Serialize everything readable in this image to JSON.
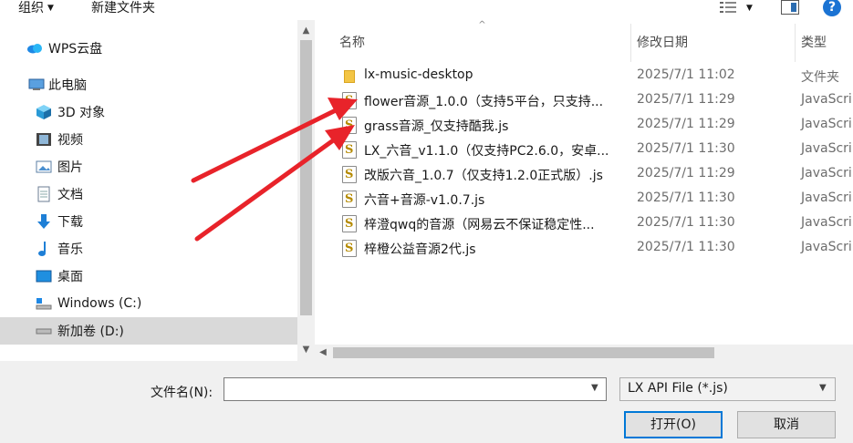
{
  "toolbar": {
    "organize_label": "组织",
    "newfolder_label": "新建文件夹",
    "help_label": "?"
  },
  "nav": {
    "items": [
      {
        "label": "WPS云盘",
        "icon": "cloud-icon"
      },
      {
        "label": "此电脑",
        "icon": "computer-icon"
      },
      {
        "label": "3D 对象",
        "icon": "cube-icon"
      },
      {
        "label": "视频",
        "icon": "video-icon"
      },
      {
        "label": "图片",
        "icon": "picture-icon"
      },
      {
        "label": "文档",
        "icon": "document-icon"
      },
      {
        "label": "下载",
        "icon": "download-icon"
      },
      {
        "label": "音乐",
        "icon": "music-icon"
      },
      {
        "label": "桌面",
        "icon": "desktop-icon"
      },
      {
        "label": "Windows (C:)",
        "icon": "drive-c-icon"
      },
      {
        "label": "新加卷 (D:)",
        "icon": "drive-d-icon"
      }
    ],
    "selected_index": 10
  },
  "list": {
    "columns": {
      "name": "名称",
      "date": "修改日期",
      "type": "类型"
    },
    "rows": [
      {
        "name": "lx-music-desktop",
        "date": "2025/7/1 11:02",
        "type": "文件夹",
        "kind": "folder"
      },
      {
        "name": "flower音源_1.0.0（支持5平台，只支持...",
        "date": "2025/7/1 11:29",
        "type": "JavaScri",
        "kind": "js"
      },
      {
        "name": "grass音源_仅支持酷我.js",
        "date": "2025/7/1 11:29",
        "type": "JavaScri",
        "kind": "js"
      },
      {
        "name": "LX_六音_v1.1.0（仅支持PC2.6.0，安卓...",
        "date": "2025/7/1 11:30",
        "type": "JavaScri",
        "kind": "js"
      },
      {
        "name": "改版六音_1.0.7（仅支持1.2.0正式版）.js",
        "date": "2025/7/1 11:29",
        "type": "JavaScri",
        "kind": "js"
      },
      {
        "name": "六音+音源-v1.0.7.js",
        "date": "2025/7/1 11:30",
        "type": "JavaScri",
        "kind": "js"
      },
      {
        "name": "梓澄qwq的音源（网易云不保证稳定性...",
        "date": "2025/7/1 11:30",
        "type": "JavaScri",
        "kind": "js"
      },
      {
        "name": "梓橙公益音源2代.js",
        "date": "2025/7/1 11:30",
        "type": "JavaScri",
        "kind": "js"
      }
    ]
  },
  "bottom": {
    "filename_label": "文件名(N):",
    "filename_value": "",
    "filetype_value": "LX API File (*.js)",
    "open_label": "打开(O)",
    "cancel_label": "取消"
  },
  "colors": {
    "annotation_arrow": "#e8232a",
    "selection": "#d9d9d9",
    "accent": "#0078d7"
  }
}
